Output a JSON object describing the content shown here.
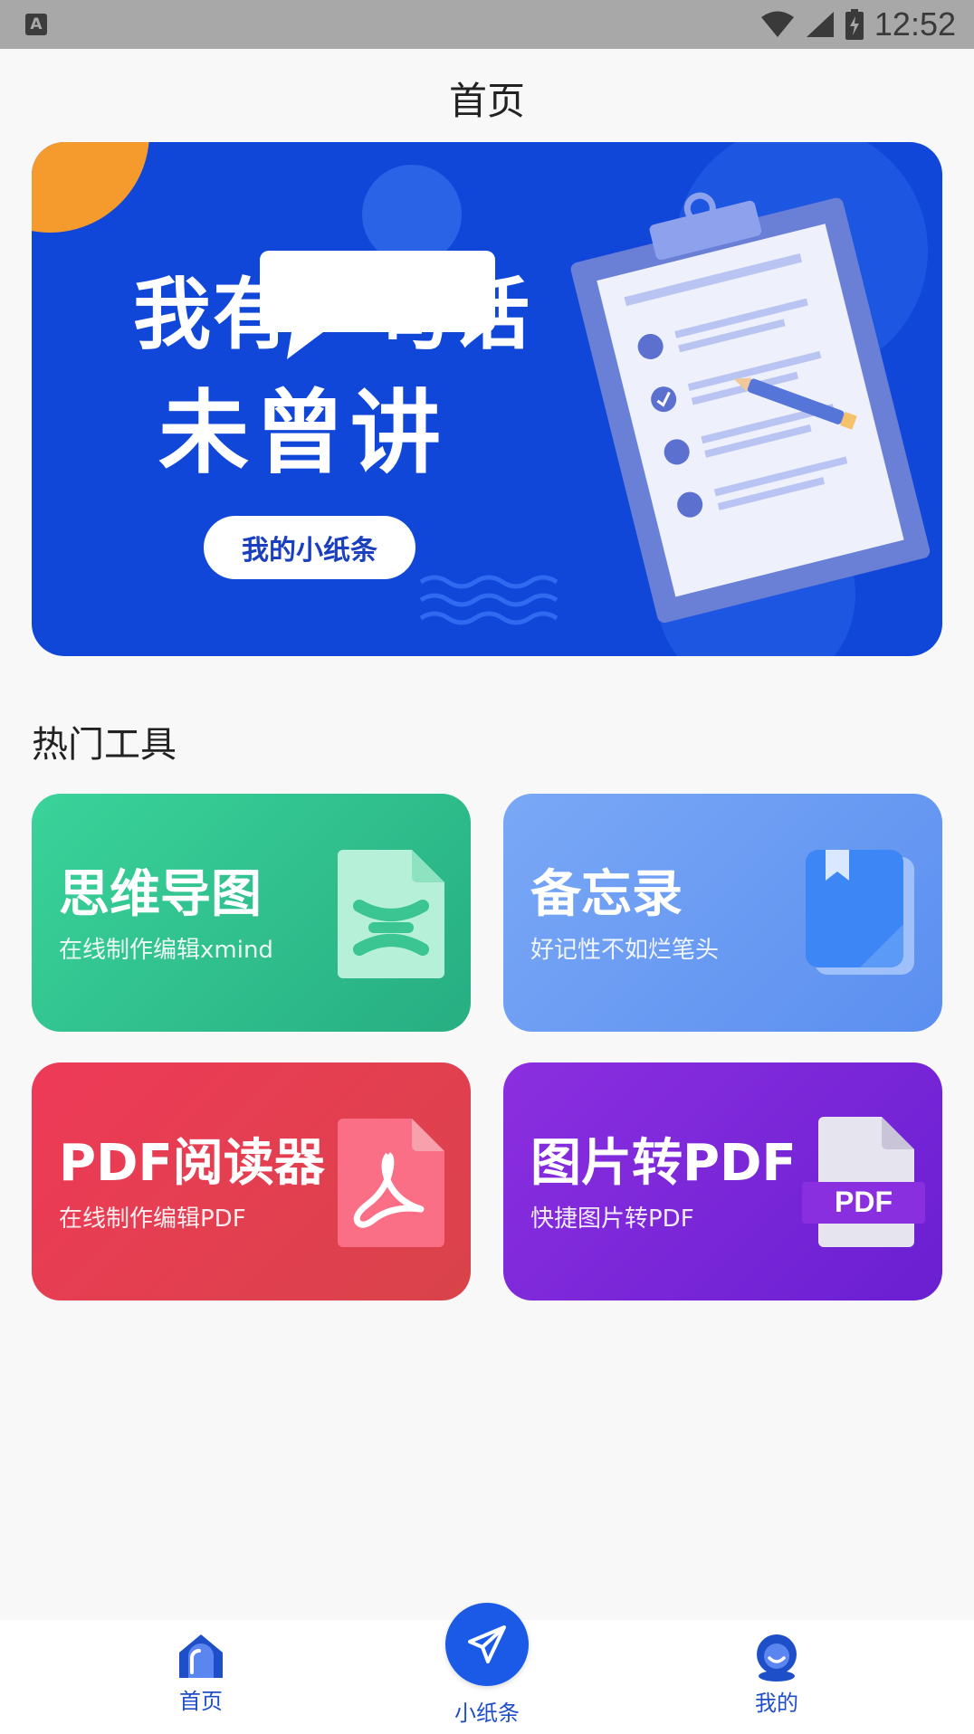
{
  "status_bar": {
    "time": "12:52",
    "notification_icon_letter": "A"
  },
  "header": {
    "title": "首页"
  },
  "banner": {
    "line1": "我有一句话",
    "line2": "未曾讲",
    "button_label": "我的小纸条"
  },
  "section": {
    "title": "热门工具"
  },
  "tools": [
    {
      "title": "思维导图",
      "subtitle": "在线制作编辑xmind",
      "icon": "xmind-file-icon"
    },
    {
      "title": "备忘录",
      "subtitle": "好记性不如烂笔头",
      "icon": "notebook-icon"
    },
    {
      "title": "PDF阅读器",
      "subtitle": "在线制作编辑PDF",
      "icon": "acrobat-file-icon"
    },
    {
      "title": "图片转PDF",
      "subtitle": "快捷图片转PDF",
      "icon": "pdf-file-icon",
      "badge": "PDF"
    }
  ],
  "bottom_nav": {
    "home": "首页",
    "notes": "小纸条",
    "mine": "我的"
  },
  "colors": {
    "accent": "#1a5ae6",
    "banner_bg": "#1047d8",
    "mindmap": "#2ec08e",
    "memo": "#6b9af3",
    "pdf_reader": "#e43d50",
    "img_to_pdf": "#7a27d9"
  }
}
